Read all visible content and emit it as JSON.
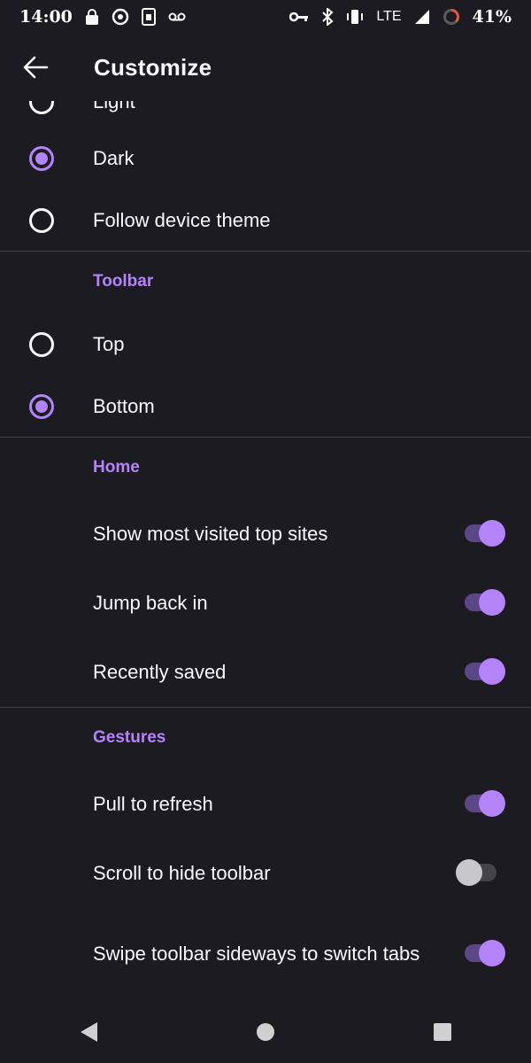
{
  "status_bar": {
    "time": "14:00",
    "network": "LTE",
    "battery": "41%",
    "left_icons": [
      "lock-icon",
      "data-saver-icon",
      "sim-icon",
      "voicemail-icon"
    ],
    "right_icons": [
      "vpn-key-icon",
      "bluetooth-icon",
      "vibrate-icon",
      "signal-icon",
      "battery-ring-icon"
    ]
  },
  "app_bar": {
    "title": "Customize",
    "back_icon": "back-arrow-icon"
  },
  "theme": {
    "options": [
      {
        "label": "Light",
        "checked": false
      },
      {
        "label": "Dark",
        "checked": true
      },
      {
        "label": "Follow device theme",
        "checked": false
      }
    ]
  },
  "toolbar": {
    "header": "Toolbar",
    "options": [
      {
        "label": "Top",
        "checked": false
      },
      {
        "label": "Bottom",
        "checked": true
      }
    ]
  },
  "home": {
    "header": "Home",
    "items": [
      {
        "label": "Show most visited top sites",
        "on": true
      },
      {
        "label": "Jump back in",
        "on": true
      },
      {
        "label": "Recently saved",
        "on": true
      }
    ]
  },
  "gestures": {
    "header": "Gestures",
    "items": [
      {
        "label": "Pull to refresh",
        "on": true
      },
      {
        "label": "Scroll to hide toolbar",
        "on": false
      },
      {
        "label": "Swipe toolbar sideways to switch tabs",
        "on": true
      }
    ]
  },
  "nav_bar": {
    "icons": [
      "nav-back-icon",
      "nav-home-icon",
      "nav-recents-icon"
    ]
  },
  "colors": {
    "accent": "#b583f9",
    "background": "#1c1b22",
    "text": "#fbfbfe",
    "divider": "#3f3e46"
  }
}
